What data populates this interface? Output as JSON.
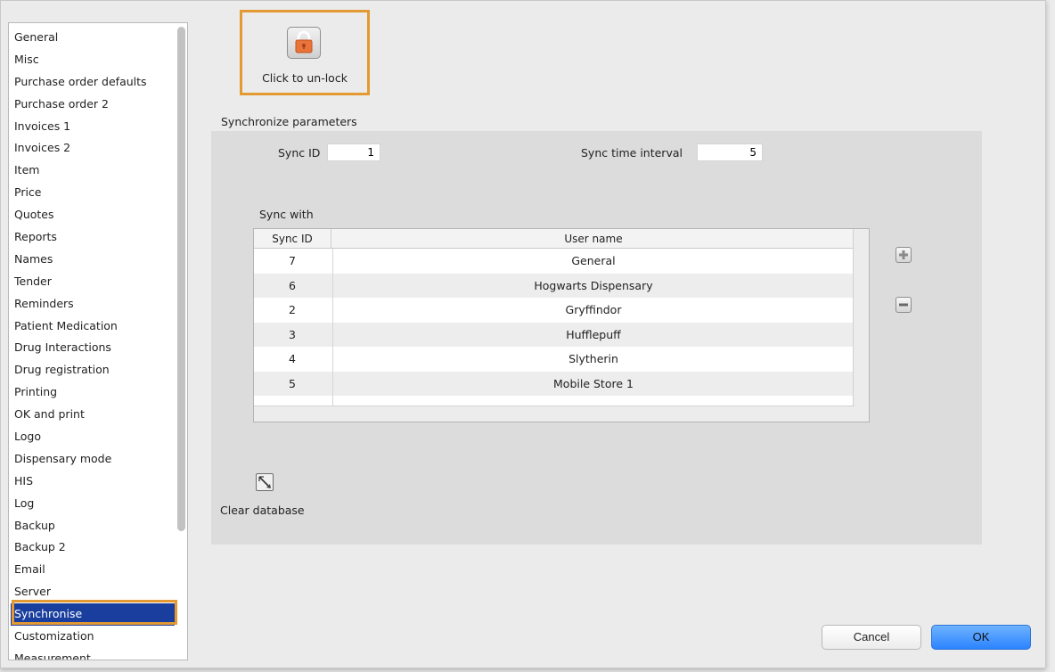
{
  "sidebar": {
    "items": [
      {
        "label": "General"
      },
      {
        "label": "Misc"
      },
      {
        "label": "Purchase order defaults"
      },
      {
        "label": "Purchase order 2"
      },
      {
        "label": "Invoices 1"
      },
      {
        "label": "Invoices 2"
      },
      {
        "label": "Item"
      },
      {
        "label": "Price"
      },
      {
        "label": "Quotes"
      },
      {
        "label": "Reports"
      },
      {
        "label": "Names"
      },
      {
        "label": "Tender"
      },
      {
        "label": "Reminders"
      },
      {
        "label": "Patient Medication"
      },
      {
        "label": "Drug Interactions"
      },
      {
        "label": "Drug registration"
      },
      {
        "label": "Printing"
      },
      {
        "label": "OK and print"
      },
      {
        "label": "Logo"
      },
      {
        "label": "Dispensary mode"
      },
      {
        "label": "HIS"
      },
      {
        "label": "Log"
      },
      {
        "label": "Backup"
      },
      {
        "label": "Backup 2"
      },
      {
        "label": "Email"
      },
      {
        "label": "Server"
      },
      {
        "label": "Synchronise"
      },
      {
        "label": "Customization"
      },
      {
        "label": "Measurement"
      }
    ],
    "selected": "Synchronise"
  },
  "lock": {
    "label": "Click to un-lock",
    "icon": "lock-icon",
    "color": "#e8743b"
  },
  "params": {
    "title": "Synchronize parameters",
    "sync_id_label": "Sync ID",
    "sync_id_value": "1",
    "sync_interval_label": "Sync time interval",
    "sync_interval_value": "5"
  },
  "sync_with": {
    "label": "Sync with",
    "columns": [
      "Sync ID",
      "User name"
    ],
    "rows": [
      {
        "id": "7",
        "name": "General"
      },
      {
        "id": "6",
        "name": "Hogwarts Dispensary"
      },
      {
        "id": "2",
        "name": "Gryffindor"
      },
      {
        "id": "3",
        "name": "Hufflepuff"
      },
      {
        "id": "4",
        "name": "Slytherin"
      },
      {
        "id": "5",
        "name": "Mobile Store 1"
      },
      {
        "id": "",
        "name": ""
      }
    ]
  },
  "actions": {
    "add_icon": "plus-icon",
    "remove_icon": "minus-icon",
    "clear_label": "Clear database",
    "clear_icon": "broom-icon"
  },
  "buttons": {
    "cancel": "Cancel",
    "ok": "OK"
  },
  "colors": {
    "highlight": "#e49a32",
    "selection": "#1a3e9e",
    "ok_button": "#2b83ff"
  }
}
